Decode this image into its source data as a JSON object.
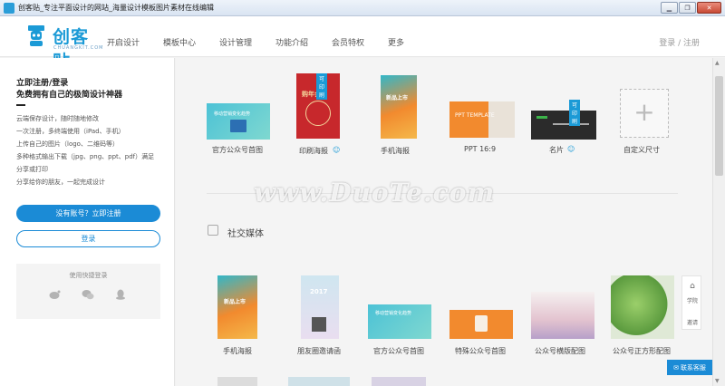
{
  "window": {
    "title": "创客贴_专注平面设计的网站_海量设计模板图片素材在线编辑"
  },
  "header": {
    "logo_text": "创客贴",
    "logo_sub": "CHUANGKIT.COM",
    "nav": [
      "开启设计",
      "模板中心",
      "设计管理",
      "功能介绍",
      "会员特权",
      "更多"
    ],
    "login": "登录 / 注册"
  },
  "left": {
    "title": "立即注册/登录",
    "subtitle": "免费拥有自己的极简设计神器",
    "features": [
      "云端保存设计，随时随地修改",
      "一次注册，多终端使用（iPad、手机）",
      "上传自己的图片（logo、二维码等）",
      "多种格式输出下载（jpg、png、ppt、pdf）满足",
      "分享或打印",
      "分享给你的朋友，一起完成设计"
    ],
    "register_btn": "没有账号？立即注册",
    "login_btn": "登录",
    "quick_login": "使用快捷登录"
  },
  "templates_top": [
    {
      "label": "官方公众号首图",
      "thumb_text": "移动营销变化趋势"
    },
    {
      "label": "印刷海报",
      "thumb_text": "购年会开",
      "badge": "可印刷"
    },
    {
      "label": "手机海报",
      "thumb_text": "新品上市"
    },
    {
      "label": "PPT 16:9",
      "thumb_text": "PPT TEMPLATE"
    },
    {
      "label": "名片",
      "badge": "可印刷"
    },
    {
      "label": "自定义尺寸"
    }
  ],
  "section": {
    "title": "社交媒体"
  },
  "templates_social": [
    {
      "label": "手机海报",
      "thumb_text": "新品上市"
    },
    {
      "label": "朋友圈邀请函",
      "thumb_text": "2017"
    },
    {
      "label": "官方公众号首图",
      "thumb_text": "移动营销变化趋势"
    },
    {
      "label": "特殊公众号首图",
      "thumb_text": ""
    },
    {
      "label": "公众号横版配图",
      "thumb_text": ""
    },
    {
      "label": "公众号正方形配图",
      "thumb_text": ""
    }
  ],
  "side_float": {
    "top_label": "学院",
    "bottom_label": "邀请"
  },
  "contact_btn": "联系客服",
  "watermark": "www.DuoTe.com",
  "colors": {
    "brand": "#1b8bd6",
    "accent_orange": "#f28a2e"
  }
}
